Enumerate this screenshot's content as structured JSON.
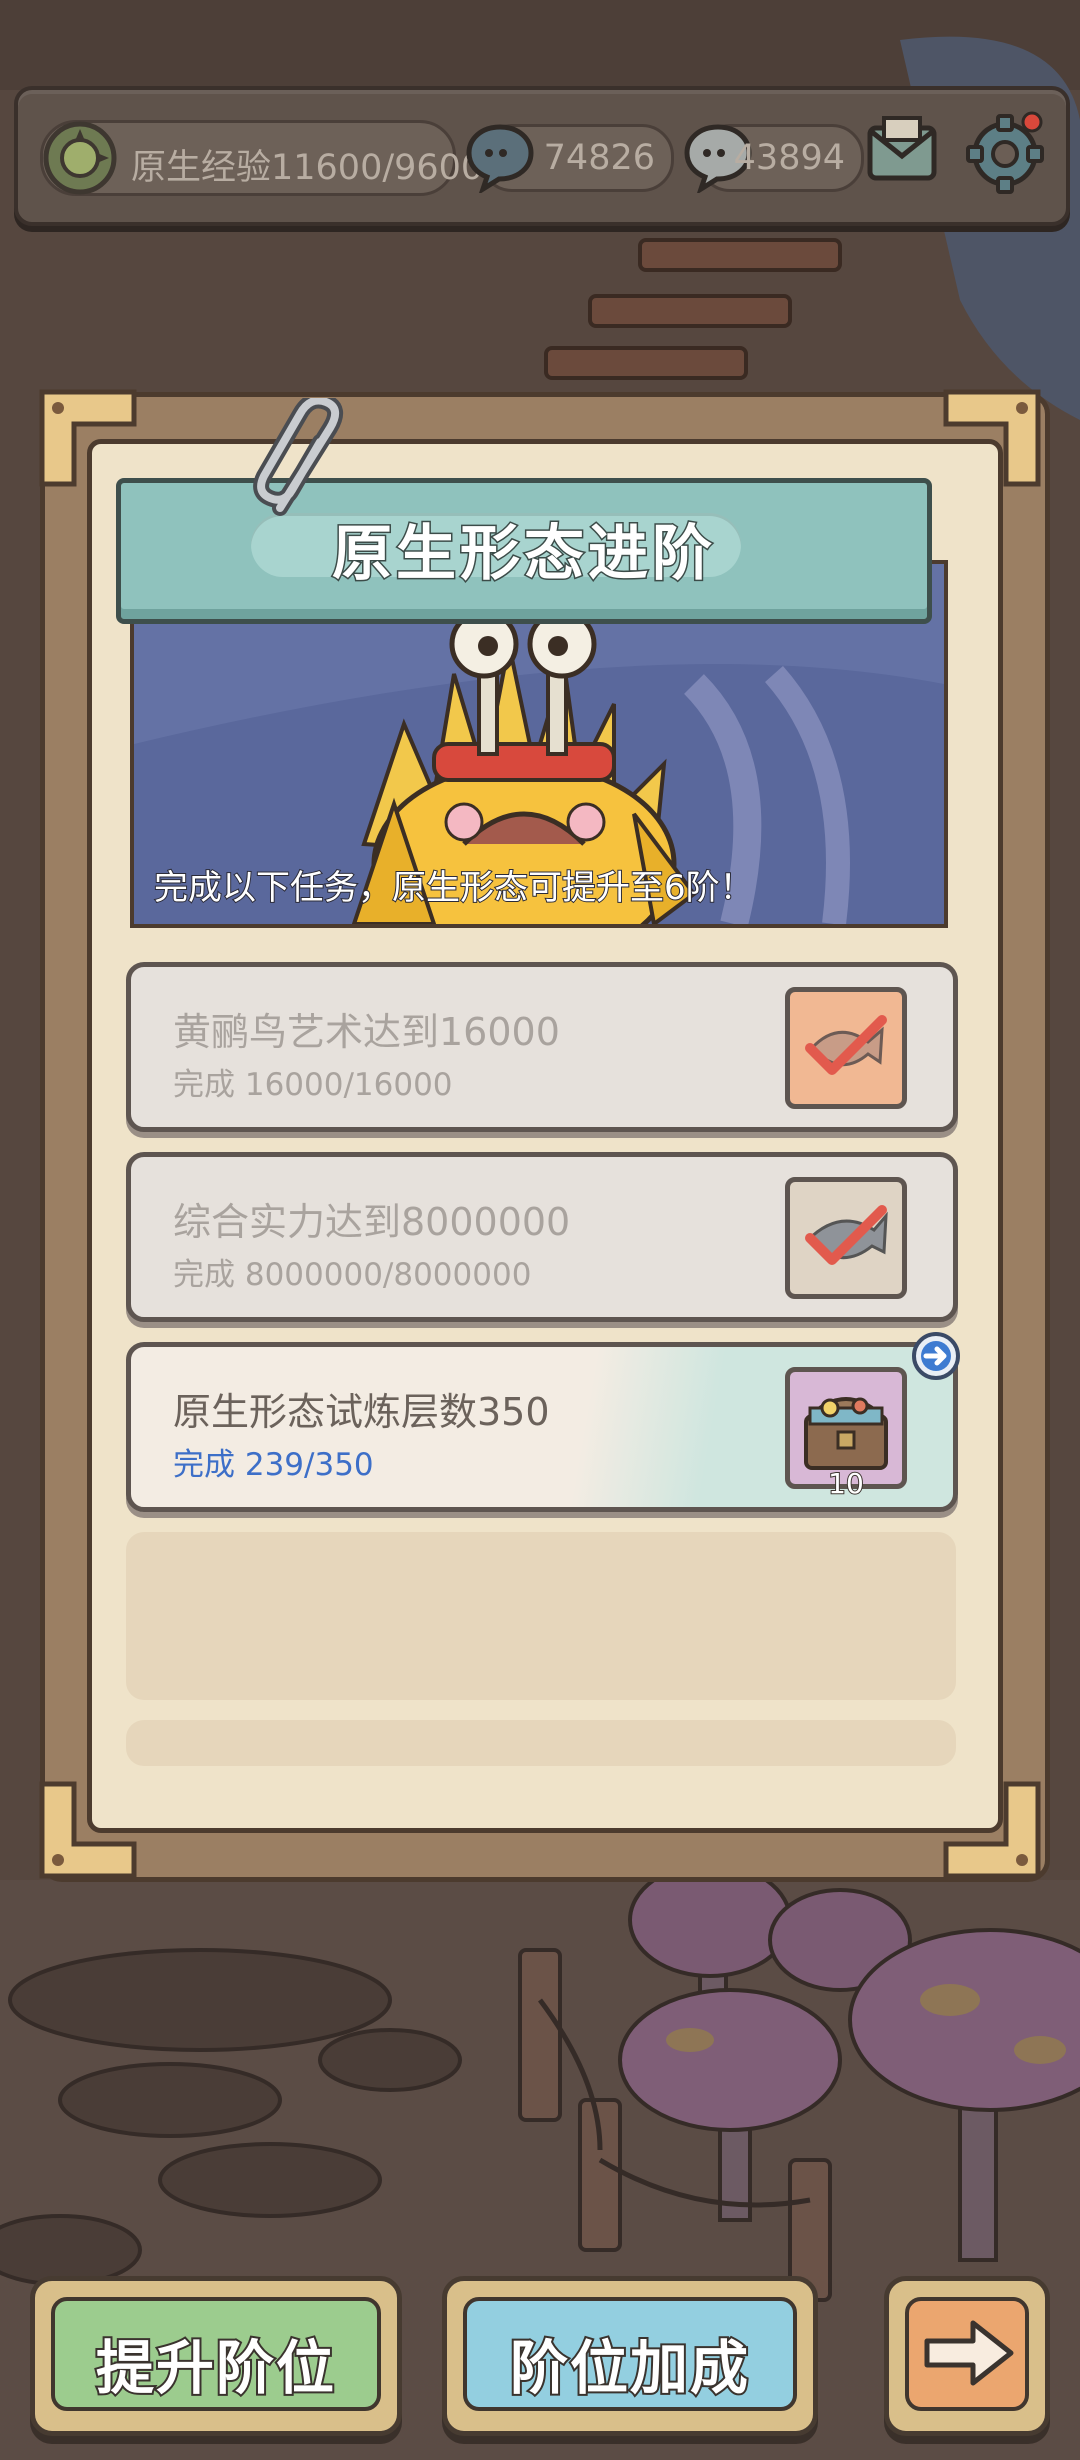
{
  "topbar": {
    "exp_label": "原生经验11600/9600",
    "currency1": "74826",
    "currency2": "43894"
  },
  "panel": {
    "title": "原生形态进阶",
    "caption": "完成以下任务，原生形态可提升至6阶！"
  },
  "tasks": [
    {
      "title": "黄鹂鸟艺术达到16000",
      "progress": "完成  16000/16000",
      "state": "done"
    },
    {
      "title": "综合实力达到8000000",
      "progress": "完成  8000000/8000000",
      "state": "done"
    },
    {
      "title": "原生形态试炼层数350",
      "progress": "完成  239/350",
      "state": "active",
      "reward_count": "10"
    }
  ],
  "buttons": {
    "upgrade": "提升阶位",
    "bonus": "阶位加成"
  },
  "colors": {
    "accent_blue": "#3d6fc8",
    "banner_teal": "#8fc2bd",
    "upgrade_green": "#9ccc8e",
    "bonus_blue": "#93cfe0",
    "arrow_orange": "#eba66f"
  }
}
